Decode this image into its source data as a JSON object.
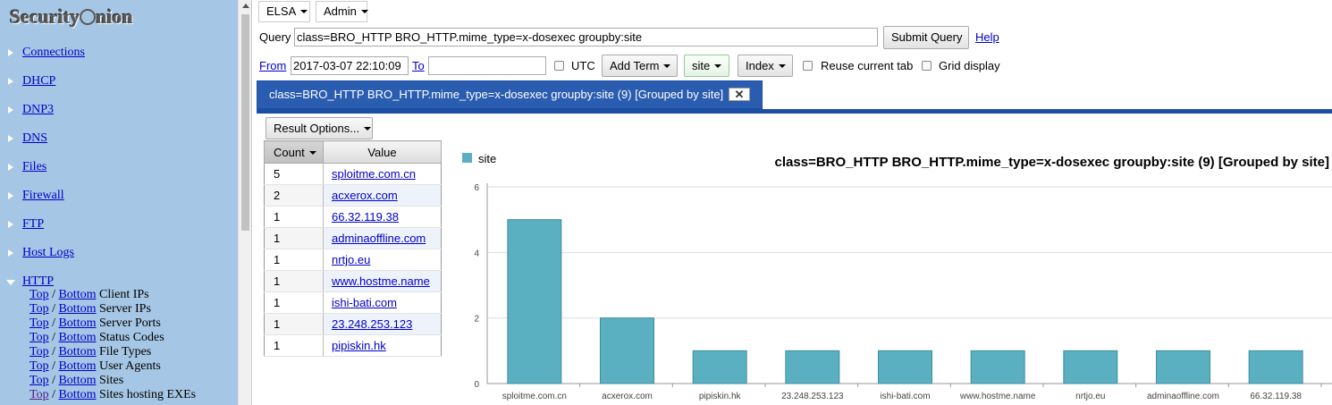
{
  "sidebar": {
    "logo": "SecurityOnion",
    "items": [
      {
        "label": "Connections",
        "expanded": false
      },
      {
        "label": "DHCP",
        "expanded": false
      },
      {
        "label": "DNP3",
        "expanded": false
      },
      {
        "label": "DNS",
        "expanded": false
      },
      {
        "label": "Files",
        "expanded": false
      },
      {
        "label": "Firewall",
        "expanded": false
      },
      {
        "label": "FTP",
        "expanded": false
      },
      {
        "label": "Host Logs",
        "expanded": false
      },
      {
        "label": "HTTP",
        "expanded": true
      }
    ],
    "http_subitems": [
      {
        "top": "Top",
        "sep": " / ",
        "bottom": "Bottom",
        "text": " Client IPs"
      },
      {
        "top": "Top",
        "sep": " / ",
        "bottom": "Bottom",
        "text": " Server IPs"
      },
      {
        "top": "Top",
        "sep": " / ",
        "bottom": "Bottom",
        "text": " Server Ports"
      },
      {
        "top": "Top",
        "sep": " / ",
        "bottom": "Bottom",
        "text": " Status Codes"
      },
      {
        "top": "Top",
        "sep": " / ",
        "bottom": "Bottom",
        "text": " File Types"
      },
      {
        "top": "Top",
        "sep": " / ",
        "bottom": "Bottom",
        "text": " User Agents"
      },
      {
        "top": "Top",
        "sep": " / ",
        "bottom": "Bottom",
        "text": " Sites"
      },
      {
        "top": "Top",
        "sep": " / ",
        "bottom": "Bottom",
        "text": " Sites hosting EXEs"
      }
    ]
  },
  "menubar": {
    "elsa": "ELSA",
    "admin": "Admin"
  },
  "query": {
    "label": "Query",
    "value": "class=BRO_HTTP BRO_HTTP.mime_type=x-dosexec groupby:site",
    "submit": "Submit Query",
    "help": "Help"
  },
  "filters": {
    "from_label": "From",
    "from_value": "2017-03-07 22:10:09",
    "to_label": "To",
    "to_value": "",
    "utc_label": "UTC",
    "add_term": "Add Term",
    "site": "site",
    "index": "Index",
    "reuse_tab_label": "Reuse current tab",
    "grid_display_label": "Grid display"
  },
  "tab": {
    "title": "class=BRO_HTTP BRO_HTTP.mime_type=x-dosexec groupby:site (9) [Grouped by site]",
    "close": "✕"
  },
  "result_options": "Result Options...",
  "table": {
    "headers": {
      "count": "Count",
      "value": "Value"
    },
    "rows": [
      {
        "count": "5",
        "value": "sploitme.com.cn"
      },
      {
        "count": "2",
        "value": "acxerox.com"
      },
      {
        "count": "1",
        "value": "66.32.119.38"
      },
      {
        "count": "1",
        "value": "adminaoffline.com"
      },
      {
        "count": "1",
        "value": "nrtjo.eu"
      },
      {
        "count": "1",
        "value": "www.hostme.name"
      },
      {
        "count": "1",
        "value": "ishi-bati.com"
      },
      {
        "count": "1",
        "value": "23.248.253.123"
      },
      {
        "count": "1",
        "value": "pipiskin.hk"
      }
    ]
  },
  "chart_data": {
    "type": "bar",
    "title": "class=BRO_HTTP BRO_HTTP.mime_type=x-dosexec groupby:site (9) [Grouped by site]",
    "categories": [
      "sploitme.com.cn",
      "acxerox.com",
      "pipiskin.hk",
      "23.248.253.123",
      "ishi-bati.com",
      "www.hostme.name",
      "nrtjo.eu",
      "adminaoffline.com",
      "66.32.119.38"
    ],
    "series": [
      {
        "name": "site",
        "values": [
          5,
          2,
          1,
          1,
          1,
          1,
          1,
          1,
          1
        ]
      }
    ],
    "yticks": [
      "0",
      "2",
      "4",
      "6"
    ],
    "ylim": [
      0,
      6
    ],
    "legend": "top-left",
    "grid": true,
    "bar_color": "#5aafc0"
  }
}
